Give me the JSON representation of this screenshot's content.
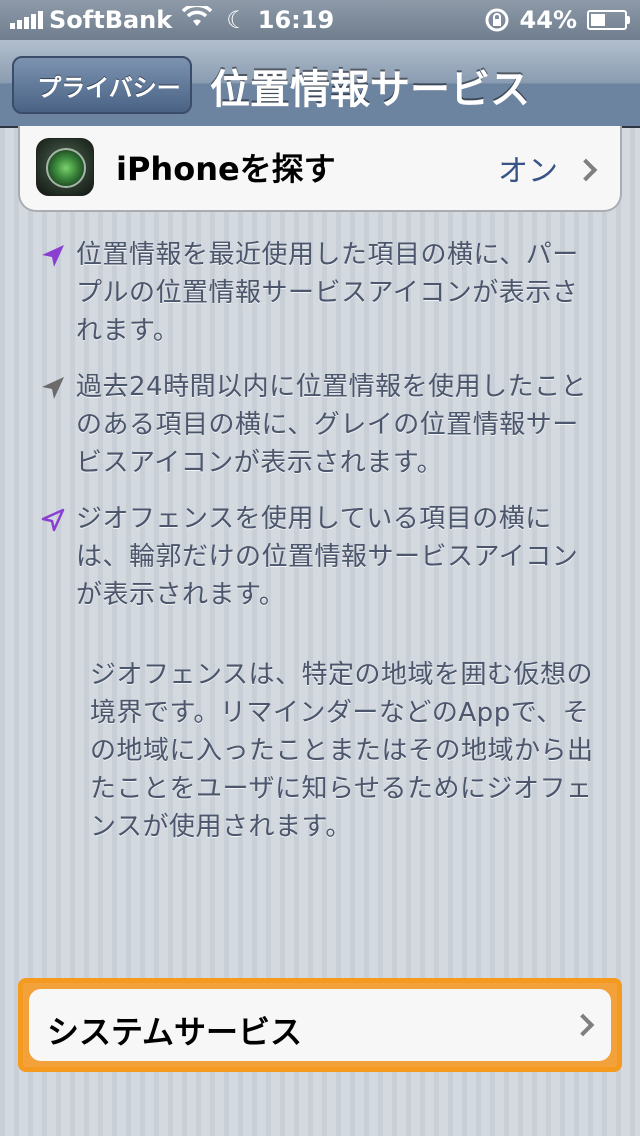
{
  "status_bar": {
    "carrier": "SoftBank",
    "time": "16:19",
    "battery": "44%",
    "battery_level": 0.44,
    "icons": [
      "signal-icon",
      "wifi-icon",
      "moon-icon",
      "rotation-lock-icon",
      "battery-icon"
    ]
  },
  "nav": {
    "back_label": "プライバシー",
    "title": "位置情報サービス"
  },
  "find_iphone": {
    "label": "iPhoneを探す",
    "value": "オン",
    "icon": "find-iphone-icon"
  },
  "notes": [
    {
      "icon": "purple-location-arrow-icon",
      "color": "#8a3fd1",
      "text": "位置情報を最近使用した項目の横に、パープルの位置情報サービスアイコンが表示されます。"
    },
    {
      "icon": "gray-location-arrow-icon",
      "color": "#6b6b6b",
      "text": "過去24時間以内に位置情報を使用したことのある項目の横に、グレイの位置情報サービスアイコンが表示されます。"
    },
    {
      "icon": "outline-location-arrow-icon",
      "color": "#8a3fd1",
      "text": "ジオフェンスを使用している項目の横には、輪郭だけの位置情報サービスアイコンが表示されます。"
    }
  ],
  "geofence_description": "ジオフェンスは、特定の地域を囲む仮想の境界です。リマインダーなどのAppで、その地域に入ったことまたはその地域から出たことをユーザに知らせるためにジオフェンスが使用されます。",
  "system_services": {
    "label": "システムサービス"
  },
  "colors": {
    "nav_bar": "#6d84a0",
    "highlight": "#f39a1f",
    "value_text": "#385487"
  }
}
